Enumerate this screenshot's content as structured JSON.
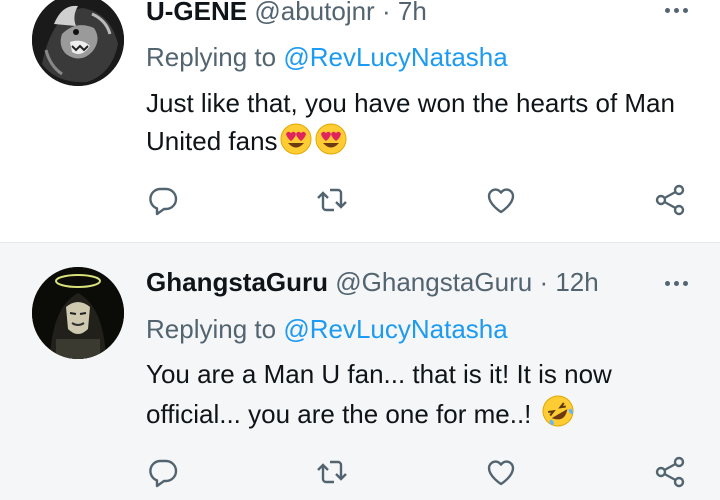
{
  "tweets": [
    {
      "display_name": "U-GENE",
      "handle": "@abutojnr",
      "separator": "·",
      "time": "7h",
      "replying_prefix": "Replying to",
      "replying_to": "@RevLucyNatasha",
      "text": "Just like that, you have won the hearts of Man United fans",
      "emojis": [
        "heart-eyes-emoji",
        "heart-eyes-emoji"
      ],
      "avatar": "lion-avatar"
    },
    {
      "display_name": "GhangstaGuru",
      "handle": "@GhangstaGuru",
      "separator": "·",
      "time": "12h",
      "replying_prefix": "Replying to",
      "replying_to": "@RevLucyNatasha",
      "text": "You are a Man U fan... that is it! It is now official... you are the one for me..!",
      "emojis": [
        "rolling-on-floor-laughing-emoji"
      ],
      "avatar": "hooded-mask-avatar"
    }
  ],
  "actions": [
    "reply-icon",
    "retweet-icon",
    "like-icon",
    "share-icon"
  ],
  "colors": {
    "link": "#1d9bf0",
    "secondary_text": "#536471",
    "primary_text": "#0f1419",
    "second_background": "#f5f6f7"
  }
}
